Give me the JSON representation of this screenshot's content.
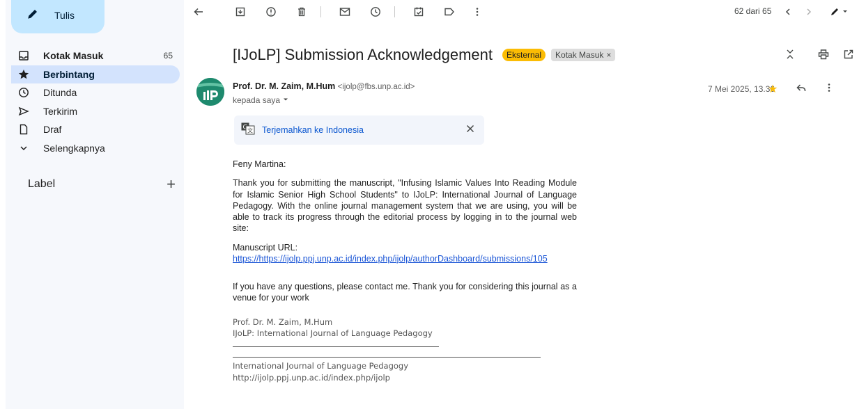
{
  "sidebar": {
    "compose_label": "Tulis",
    "nav": [
      {
        "label": "Kotak Masuk",
        "count": "65",
        "icon": "inbox-icon"
      },
      {
        "label": "Berbintang",
        "count": "",
        "icon": "star-icon"
      },
      {
        "label": "Ditunda",
        "count": "",
        "icon": "clock-icon"
      },
      {
        "label": "Terkirim",
        "count": "",
        "icon": "send-icon"
      },
      {
        "label": "Draf",
        "count": "",
        "icon": "draft-icon"
      },
      {
        "label": "Selengkapnya",
        "count": "",
        "icon": "chevron-down-icon"
      }
    ],
    "label_title": "Label",
    "label_add": "+"
  },
  "toolbar": {
    "pager_text": "62 dari 65"
  },
  "email": {
    "subject": "[IJoLP] Submission Acknowledgement",
    "chip_external": "Eksternal",
    "chip_inbox": "Kotak Masuk",
    "chip_inbox_close": "×",
    "sender_name": "Prof. Dr. M. Zaim, M.Hum",
    "sender_email": "<ijolp@fbs.unp.ac.id>",
    "to_line": "kepada saya",
    "date": "7 Mei 2025, 13.36",
    "translate_link": "Terjemahkan ke Indonesia",
    "greeting": "Feny Martina:",
    "para1": "Thank you for submitting the manuscript, \"Infusing Islamic Values Into Reading Module for Islamic Senior High School Students\" to IJoLP: International Journal of Language Pedagogy. With the online journal management system that we are using, you will be able to track its progress through the editorial process by logging in to the journal web site:",
    "url_label": "Manuscript URL:",
    "url": "https://https://ijolp.ppj.unp.ac.id/index.php/ijolp/authorDashboard/submissions/105",
    "para2": "If you have any questions, please contact me. Thank you for considering this journal as a venue for your work",
    "sig_name": "Prof. Dr. M. Zaim, M.Hum",
    "sig_journal": "IJoLP: International Journal of Language Pedagogy",
    "footer_journal": "International Journal of Language Pedagogy",
    "footer_url": "http://ijolp.ppj.unp.ac.id/index.php/ijolp"
  },
  "colors": {
    "accent": "#0b57d0",
    "compose_bg": "#c2e7ff",
    "active_nav": "#d3e3fd",
    "external_chip": "#fbbc04"
  }
}
